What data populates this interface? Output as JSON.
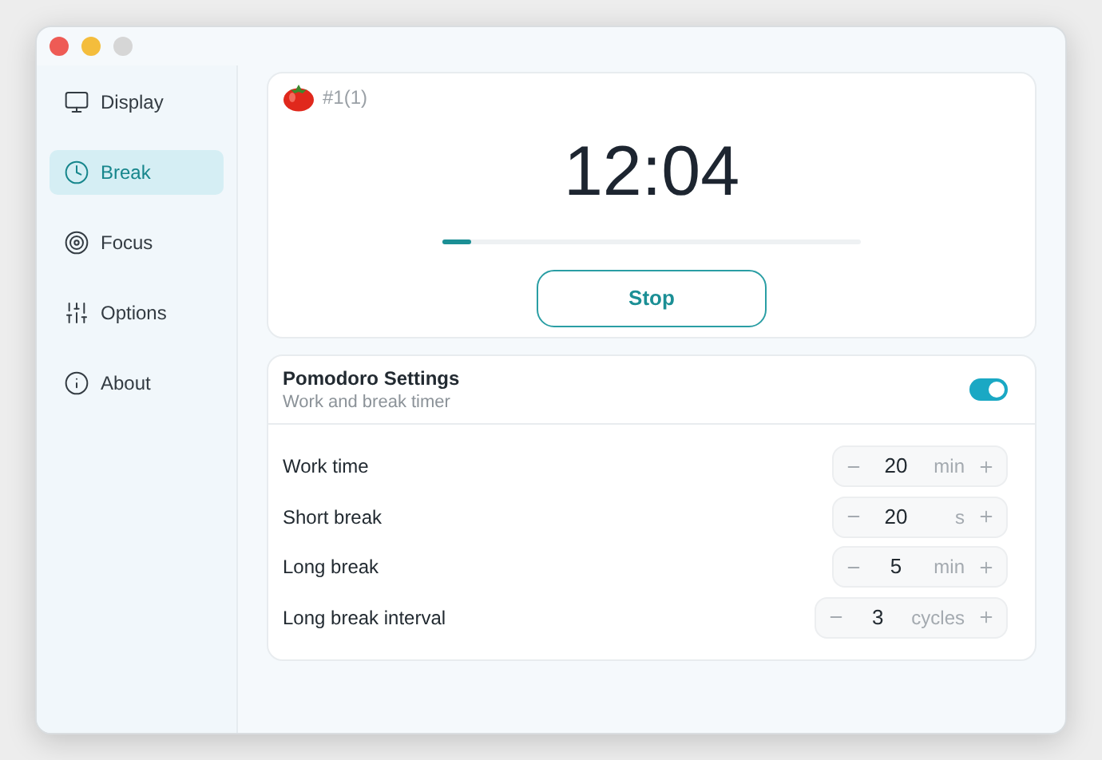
{
  "sidebar": {
    "items": [
      {
        "label": "Display",
        "selected": false
      },
      {
        "label": "Break",
        "selected": true
      },
      {
        "label": "Focus",
        "selected": false
      },
      {
        "label": "Options",
        "selected": false
      },
      {
        "label": "About",
        "selected": false
      }
    ]
  },
  "timer": {
    "session": "#1(1)",
    "time": "12:04",
    "progress": {
      "level": 0.07
    },
    "button": "Stop"
  },
  "settings": {
    "title": "Pomodoro Settings",
    "subtitle": "Work and break timer",
    "enabled": true,
    "rows": [
      {
        "label": "Work time",
        "value": "20",
        "unit": "min"
      },
      {
        "label": "Short break",
        "value": "20",
        "unit": "s"
      },
      {
        "label": "Long break",
        "value": "5",
        "unit": "min"
      },
      {
        "label": "Long break interval",
        "value": "3",
        "unit": "cycles"
      }
    ]
  }
}
